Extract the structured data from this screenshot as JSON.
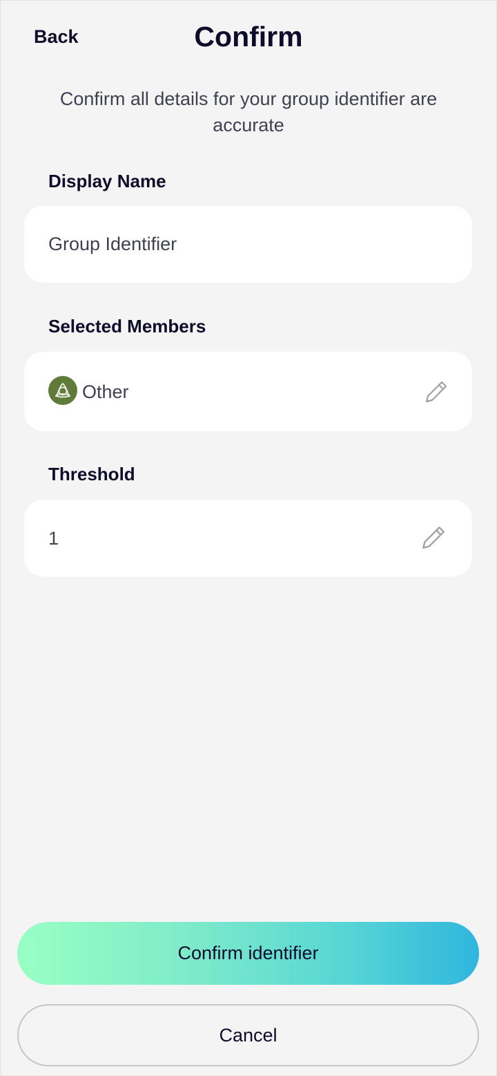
{
  "header": {
    "back_label": "Back",
    "title": "Confirm"
  },
  "subtitle": "Confirm all details for your group identifier are accurate",
  "display_name": {
    "label": "Display Name",
    "value": "Group Identifier"
  },
  "selected_members": {
    "label": "Selected Members",
    "members": [
      {
        "name": "Other",
        "avatar_color": "#5e7b3c",
        "icon": "triquetra-icon"
      }
    ],
    "edit_icon": "pencil-icon"
  },
  "threshold": {
    "label": "Threshold",
    "value": "1",
    "edit_icon": "pencil-icon"
  },
  "actions": {
    "confirm_label": "Confirm identifier",
    "cancel_label": "Cancel"
  },
  "colors": {
    "background": "#f4f4f4",
    "card": "#ffffff",
    "text_dark": "#0d0d2b",
    "text_muted": "#3d4152",
    "gradient_start": "#98ffc3",
    "gradient_end": "#2fb6de",
    "icon_gray": "#a0a0a0"
  }
}
